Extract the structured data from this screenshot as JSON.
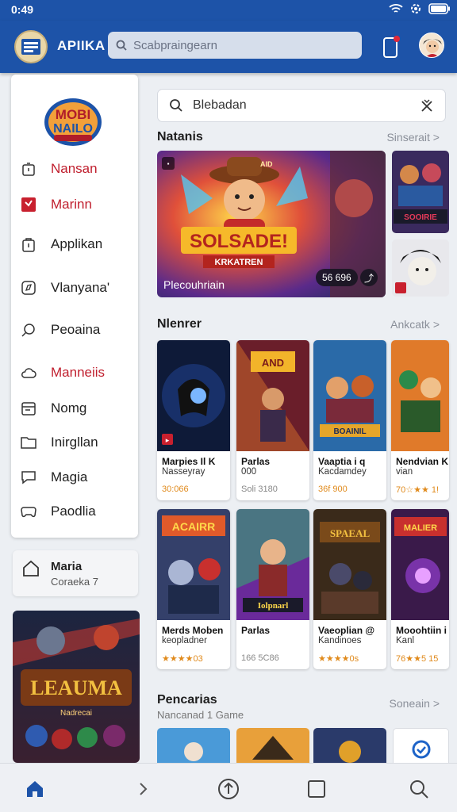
{
  "status": {
    "time": "0:49"
  },
  "app": {
    "title": "APIIKA"
  },
  "top_search": {
    "placeholder": "Scabpraingearn"
  },
  "sidebar": {
    "logo_text": [
      "MOBI",
      "NAILO"
    ],
    "items": [
      {
        "label": "Nansan",
        "icon": "timer-icon",
        "red": true
      },
      {
        "label": "Marinn",
        "icon": "red-flag-icon",
        "red": true
      },
      {
        "label": "Applikan",
        "icon": "shopping-bag-icon",
        "red": false
      },
      {
        "label": "Vlanyana'",
        "icon": "compass-icon",
        "red": false
      },
      {
        "label": "Peoaina",
        "icon": "search-icon",
        "red": false
      },
      {
        "label": "Manneiis",
        "icon": "cloud-icon",
        "red": true
      },
      {
        "label": "Nomg",
        "icon": "calendar-icon",
        "red": false
      },
      {
        "label": "Inirgllan",
        "icon": "folder-icon",
        "red": false
      },
      {
        "label": "Magia",
        "icon": "chat-icon",
        "red": false
      },
      {
        "label": "Paodlia",
        "icon": "gamepad-icon",
        "red": false
      }
    ],
    "card": {
      "title": "Maria",
      "subtitle": "Coraeka 7"
    },
    "promo": {
      "title": "LEAUMA",
      "subtitle": "Nadrecai"
    }
  },
  "content_search": {
    "value": "Blebadan"
  },
  "sections": {
    "featured": {
      "title": "Natanis",
      "see_all": "Sinserait >"
    },
    "new": {
      "title": "Nlenrer",
      "see_all": "Ankcatk >"
    },
    "pencarias": {
      "title": "Pencarias",
      "subtitle": "Nancanad 1 Game",
      "see_all": "Soneain >"
    }
  },
  "featured": {
    "banner_title": "SOLSADE!",
    "banner_sub": "KRKATREN",
    "caption": "Plecouhriain",
    "pill": "56 696",
    "side1_text": "SOOIRIE",
    "top_tag": "AID"
  },
  "game_rows": [
    [
      {
        "name": "Marpies   Il  K",
        "sub": "Nasseyray",
        "rating": "30:066",
        "grey": false,
        "img_title": ""
      },
      {
        "name": "Parlas",
        "sub": "000",
        "rating": "Soli 3180",
        "grey": true,
        "img_title": "AND"
      },
      {
        "name": "Vaaptia  i  q",
        "sub": "Kacdamdey",
        "rating": "36f 900",
        "grey": false,
        "img_title": "BOAINIL"
      },
      {
        "name": "Nendvian  K",
        "sub": "vian",
        "rating": "70☆★★ 1!",
        "grey": false,
        "img_title": ""
      }
    ],
    [
      {
        "name": "Merds Moben",
        "sub": "keopladner",
        "rating": "★★★★03",
        "grey": false,
        "img_title": "ACAIRR"
      },
      {
        "name": "Parlas",
        "sub": "",
        "rating": "166 5C86",
        "grey": true,
        "img_title": "Iolpnarl"
      },
      {
        "name": "Vaeoplian  @",
        "sub": "Kandinoes",
        "rating": "★★★★0s",
        "grey": false,
        "img_title": "SPAEAL"
      },
      {
        "name": "Mooohtiin  i",
        "sub": "Kanl",
        "rating": "76★★5 15",
        "grey": false,
        "img_title": "MALIER"
      }
    ]
  ],
  "colors": {
    "primary": "#1d53a8",
    "accent_red": "#c01f2e",
    "rating": "#e08a1c"
  }
}
